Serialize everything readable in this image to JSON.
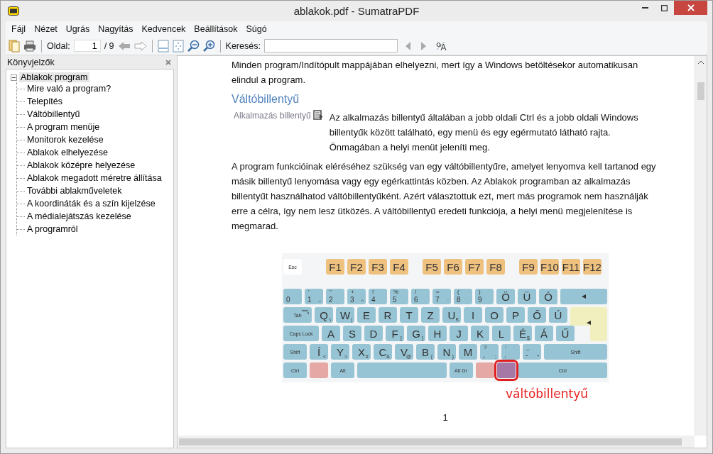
{
  "window": {
    "title": "ablakok.pdf - SumatraPDF"
  },
  "menu": [
    "Fájl",
    "Nézet",
    "Ugrás",
    "Nagyítás",
    "Kedvencek",
    "Beállítások",
    "Súgó"
  ],
  "toolbar": {
    "page_label": "Oldal:",
    "page": "1",
    "page_total": "/ 9",
    "search_label": "Keresés:"
  },
  "bookmarks": {
    "title": "Könyvjelzők",
    "items": [
      {
        "label": "Ablakok program",
        "expanded": true,
        "selected": true,
        "children": [
          {
            "label": "Mire való a program?",
            "selected": false
          },
          {
            "label": "Telepítés",
            "selected": false
          },
          {
            "label": "Váltóbillentyű",
            "selected": false
          },
          {
            "label": "A program menüje",
            "selected": false
          },
          {
            "label": "Monitorok kezelése",
            "selected": false
          },
          {
            "label": "Ablakok elhelyezése",
            "selected": false
          },
          {
            "label": "Ablakok középre helyezése",
            "selected": false
          },
          {
            "label": "Ablakok megadott méretre állítása",
            "selected": false
          },
          {
            "label": "További ablakműveletek",
            "selected": false
          },
          {
            "label": "A koordináták és a szín kijelzése",
            "selected": false
          },
          {
            "label": "A médialejátszás kezelése",
            "selected": false
          },
          {
            "label": "A programról",
            "selected": false
          }
        ]
      }
    ]
  },
  "document": {
    "blocks": [
      {
        "kind": "paragraph",
        "text": "Minden program/Indítópult mappájában elhelyezni, mert így a Windows betöltésekor automatikusan elindul a program."
      },
      {
        "kind": "heading",
        "text": "Váltóbillentyű"
      },
      {
        "kind": "figure-paragraph",
        "image_label": "Alkalmazás billentyű",
        "text": "Az alkalmazás billentyű általában a jobb oldali Ctrl és a jobb oldali Windows billentyűk között található, egy menü és egy egérmutató látható rajta. Önmagában a helyi menüt jeleníti meg."
      },
      {
        "kind": "paragraph",
        "text": "A program funkcióinak eléréséhez szükség van egy váltóbillentyűre, amelyet lenyomva kell tartanod egy másik billentyű lenyomása vagy egy egérkattintás közben. Az Ablakok programban az alkalmazás billentyűt használhatod váltóbillentyűként. Azért választottuk ezt, mert más programok nem használják erre a célra, így nem lesz ütközés. A váltóbillentyű eredeti funkciója, a helyi menü megjelenítése is megmarad."
      },
      {
        "kind": "keyboard",
        "caption": "váltóbillentyű",
        "rows": [
          {
            "kind": "function",
            "groups": [
              {
                "keys": [
                  {
                    "kind": "esc",
                    "label": "Esc"
                  }
                ]
              },
              {
                "keys": [
                  {
                    "kind": "fn",
                    "label": "F1"
                  },
                  {
                    "kind": "fn",
                    "label": "F2"
                  },
                  {
                    "kind": "fn",
                    "label": "F3"
                  },
                  {
                    "kind": "fn",
                    "label": "F4"
                  }
                ]
              },
              {
                "keys": [
                  {
                    "kind": "fn",
                    "label": "F5"
                  },
                  {
                    "kind": "fn",
                    "label": "F6"
                  },
                  {
                    "kind": "fn",
                    "label": "F7"
                  },
                  {
                    "kind": "fn",
                    "label": "F8"
                  }
                ]
              },
              {
                "keys": [
                  {
                    "kind": "fn",
                    "label": "F9"
                  },
                  {
                    "kind": "fn",
                    "label": "F10"
                  },
                  {
                    "kind": "fn",
                    "label": "F11"
                  },
                  {
                    "kind": "fn",
                    "label": "F12"
                  }
                ]
              }
            ]
          },
          {
            "kind": "main",
            "keys": [
              {
                "kind": "digit",
                "label": "0"
              },
              {
                "kind": "digit",
                "top": "'",
                "label": "1",
                "alt": "~"
              },
              {
                "kind": "digit",
                "top": "\"",
                "label": "2"
              },
              {
                "kind": "digit",
                "top": "+",
                "label": "3",
                "alt": "^"
              },
              {
                "kind": "digit",
                "top": "!",
                "label": "4"
              },
              {
                "kind": "digit",
                "top": "%",
                "label": "5"
              },
              {
                "kind": "digit",
                "top": "/",
                "label": "6"
              },
              {
                "kind": "digit",
                "top": "=",
                "label": "7",
                "alt": "`"
              },
              {
                "kind": "digit",
                "top": "(",
                "label": "8"
              },
              {
                "kind": "digit",
                "top": ")",
                "label": "9"
              },
              {
                "kind": "letter",
                "label": "Ö"
              },
              {
                "kind": "letter",
                "label": "Ü"
              },
              {
                "kind": "letter",
                "label": "Ó"
              },
              {
                "kind": "backspace"
              }
            ]
          },
          {
            "kind": "main",
            "keys": [
              {
                "kind": "tab",
                "label": "Tab"
              },
              {
                "kind": "letter",
                "label": "Q",
                "alt": "\\"
              },
              {
                "kind": "letter",
                "label": "W",
                "alt": "|"
              },
              {
                "kind": "letter",
                "label": "E"
              },
              {
                "kind": "letter",
                "label": "R"
              },
              {
                "kind": "letter",
                "label": "T"
              },
              {
                "kind": "letter",
                "label": "Z"
              },
              {
                "kind": "letter",
                "label": "U",
                "alt": "€"
              },
              {
                "kind": "letter",
                "label": "I"
              },
              {
                "kind": "letter",
                "label": "O"
              },
              {
                "kind": "letter",
                "label": "P"
              },
              {
                "kind": "letter",
                "label": "Ő"
              },
              {
                "kind": "letter",
                "label": "Ú"
              },
              {
                "kind": "enter"
              }
            ]
          },
          {
            "kind": "main",
            "keys": [
              {
                "kind": "caps",
                "label": "Caps Lock"
              },
              {
                "kind": "letter",
                "label": "A"
              },
              {
                "kind": "letter",
                "label": "S"
              },
              {
                "kind": "letter",
                "label": "D"
              },
              {
                "kind": "letter",
                "label": "F",
                "alt": "["
              },
              {
                "kind": "letter",
                "label": "G",
                "alt": "]"
              },
              {
                "kind": "letter",
                "label": "H"
              },
              {
                "kind": "letter",
                "label": "J"
              },
              {
                "kind": "letter",
                "label": "K"
              },
              {
                "kind": "letter",
                "label": "L"
              },
              {
                "kind": "letter",
                "label": "É",
                "alt": "$"
              },
              {
                "kind": "letter",
                "label": "Á"
              },
              {
                "kind": "letter",
                "label": "Ű"
              },
              {
                "kind": "enter-tail"
              }
            ]
          },
          {
            "kind": "main",
            "keys": [
              {
                "kind": "mod",
                "label": "Shift"
              },
              {
                "kind": "letter",
                "label": "Í",
                "alt": "<"
              },
              {
                "kind": "letter",
                "label": "Y",
                "alt": ">"
              },
              {
                "kind": "letter",
                "label": "X",
                "alt": "#"
              },
              {
                "kind": "letter",
                "label": "C",
                "alt": "&"
              },
              {
                "kind": "letter",
                "label": "V",
                "alt": "@"
              },
              {
                "kind": "letter",
                "label": "B",
                "alt": "{"
              },
              {
                "kind": "letter",
                "label": "N",
                "alt": "}"
              },
              {
                "kind": "letter",
                "label": "M"
              },
              {
                "kind": "digit",
                "top": "?",
                "label": ",",
                "alt": ";"
              },
              {
                "kind": "digit",
                "top": ":",
                "label": "."
              },
              {
                "kind": "digit",
                "top": "_",
                "label": "-",
                "alt": "*"
              },
              {
                "kind": "wide-mod",
                "label": "Shift"
              }
            ]
          },
          {
            "kind": "main",
            "keys": [
              {
                "kind": "mod",
                "label": "Ctrl"
              },
              {
                "kind": "win",
                "highlighted": false
              },
              {
                "kind": "mod",
                "label": "Alt"
              },
              {
                "kind": "space"
              },
              {
                "kind": "mod",
                "label": "Alt Gr"
              },
              {
                "kind": "win",
                "highlighted": false
              },
              {
                "kind": "menu",
                "highlighted": true
              },
              {
                "kind": "wide-mod",
                "label": "Ctrl"
              }
            ]
          }
        ]
      }
    ],
    "page_number": "1"
  }
}
